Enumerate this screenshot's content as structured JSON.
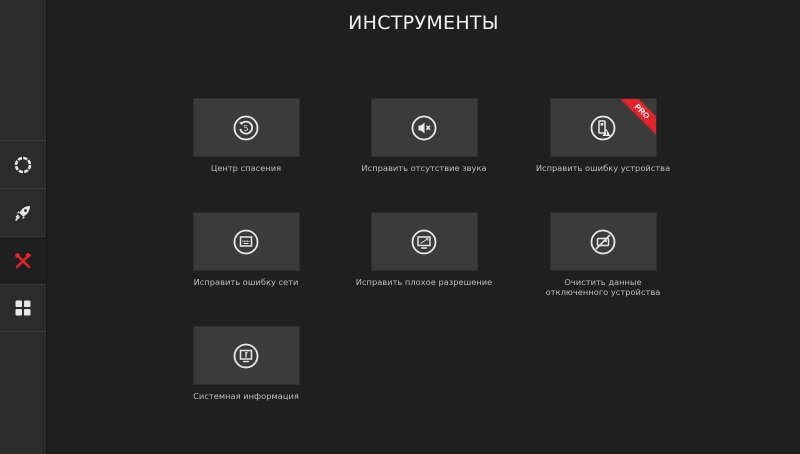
{
  "header": {
    "title": "ИНСТРУМЕНТЫ"
  },
  "sidebar": {
    "items": [
      {
        "name": "status",
        "icon": "ring-icon",
        "active": false
      },
      {
        "name": "boost",
        "icon": "rocket-icon",
        "active": false
      },
      {
        "name": "tools",
        "icon": "tools-icon",
        "active": true
      },
      {
        "name": "apps",
        "icon": "grid-icon",
        "active": false
      }
    ],
    "active_color": "#e0242b"
  },
  "tools": [
    {
      "label": "Центр спасения",
      "icon": "restore-icon",
      "pro": false
    },
    {
      "label": "Исправить отсутствие звука",
      "icon": "speaker-muted-icon",
      "pro": false
    },
    {
      "label": "Исправить ошибку устройства",
      "icon": "device-warning-icon",
      "pro": true,
      "badge": "PRO"
    },
    {
      "label": "Исправить ошибку сети",
      "icon": "network-port-icon",
      "pro": false
    },
    {
      "label": "Исправить плохое разрешение",
      "icon": "resolution-icon",
      "pro": false
    },
    {
      "label": "Очистить данные\nотключенного устройства",
      "icon": "disconnected-device-icon",
      "pro": false
    },
    {
      "label": "Системная информация",
      "icon": "system-info-icon",
      "pro": false
    }
  ]
}
